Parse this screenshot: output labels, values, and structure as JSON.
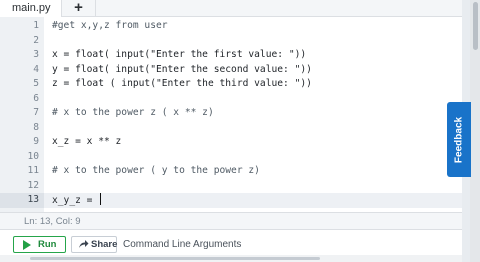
{
  "tabs": [
    {
      "label": "main.py"
    }
  ],
  "add_tab_label": "+",
  "editor": {
    "lines": [
      {
        "num": "1",
        "code": "#get x,y,z from user"
      },
      {
        "num": "2",
        "code": ""
      },
      {
        "num": "3",
        "code": "x = float( input(\"Enter the first value: \"))"
      },
      {
        "num": "4",
        "code": "y = float( input(\"Enter the second value: \"))"
      },
      {
        "num": "5",
        "code": "z = float ( input(\"Enter the third value: \"))"
      },
      {
        "num": "6",
        "code": ""
      },
      {
        "num": "7",
        "code": "# x to the power z ( x ** z)"
      },
      {
        "num": "8",
        "code": ""
      },
      {
        "num": "9",
        "code": "x_z = x ** z"
      },
      {
        "num": "10",
        "code": ""
      },
      {
        "num": "11",
        "code": "# x to the power ( y to the power z)"
      },
      {
        "num": "12",
        "code": ""
      },
      {
        "num": "13",
        "code": "x_y_z = "
      }
    ],
    "active_line": 13
  },
  "status": {
    "position": "Ln: 13,  Col: 9"
  },
  "toolbar": {
    "run_label": "Run",
    "share_label": "Share",
    "cla_label": "Command Line Arguments"
  },
  "feedback_label": "Feedback",
  "colors": {
    "accent_blue": "#1973c9",
    "run_green": "#22a045"
  }
}
